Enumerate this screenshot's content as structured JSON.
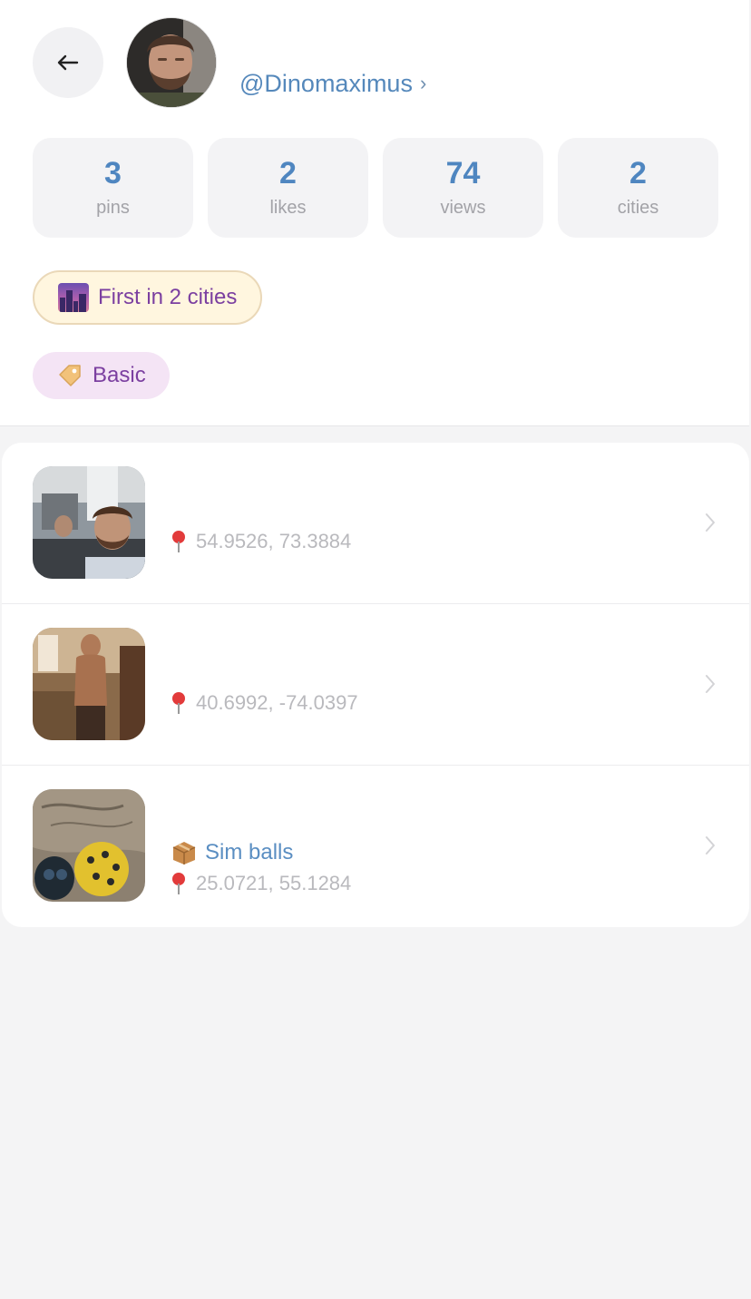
{
  "profile": {
    "username": "@Dinomaximus",
    "username_chevron": "›",
    "back_icon": "arrow-left-icon",
    "avatar": "user-avatar-photo"
  },
  "stats": [
    {
      "value": "3",
      "label": "pins"
    },
    {
      "value": "2",
      "label": "likes"
    },
    {
      "value": "74",
      "label": "views"
    },
    {
      "value": "2",
      "label": "cities"
    }
  ],
  "badges": {
    "achievement": {
      "label": "First in 2 cities",
      "icon": "night-city-icon"
    },
    "plan": {
      "label": "Basic",
      "icon": "tag-icon"
    }
  },
  "pins": [
    {
      "title": "",
      "coords": "54.9526, 73.3884",
      "thumb": "office-selfie-photo"
    },
    {
      "title": "",
      "coords": "40.6992, -74.0397",
      "thumb": "kitchen-photo"
    },
    {
      "title": "Sim balls",
      "title_icon": "package-icon",
      "coords": "25.0721, 55.1284",
      "thumb": "helmets-photo"
    }
  ],
  "colors": {
    "accent": "#4f86c0",
    "link": "#5588bb",
    "badge_text": "#7b3fa0",
    "achievement_bg": "#fff6df",
    "plan_bg": "#f4e4f5",
    "pin_red": "#e23b3b"
  }
}
